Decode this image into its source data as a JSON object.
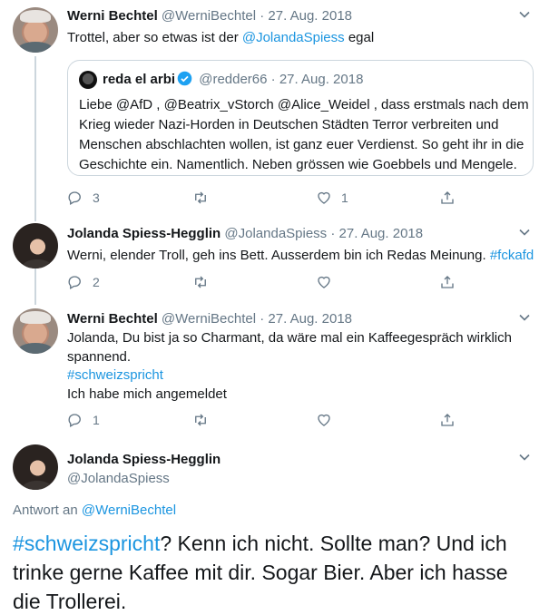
{
  "thread": [
    {
      "avatar": "werni",
      "name": "Werni Bechtel",
      "handle": "@WerniBechtel",
      "date": "· 27. Aug. 2018",
      "text_pre": "Trottel, aber so etwas ist der ",
      "text_mention": "@JolandaSpiess",
      "text_post": " egal",
      "quote": {
        "name": "reda el arbi",
        "handle": "@redder66",
        "date": "· 27. Aug. 2018",
        "lines": [
          "Liebe @AfD , @Beatrix_vStorch @Alice_Weidel , dass erstmals nach dem",
          "Krieg wieder Nazi-Horden in Deutschen Städten Terror verbreiten und",
          "Menschen abschlachten wollen, ist ganz euer Verdienst. So geht ihr in die",
          "Geschichte ein. Namentlich. Neben grössen wie Goebbels und Mengele."
        ]
      },
      "replies": "3",
      "retweets": "",
      "likes": "1"
    },
    {
      "avatar": "jolanda",
      "name": "Jolanda Spiess-Hegglin",
      "handle": "@JolandaSpiess",
      "date": "· 27. Aug. 2018",
      "text_pre": "Werni, elender Troll, geh ins Bett. Ausserdem bin ich Redas Meinung. ",
      "text_hashtag": "#fckafd",
      "replies": "2",
      "retweets": "",
      "likes": ""
    },
    {
      "avatar": "werni",
      "name": "Werni Bechtel",
      "handle": "@WerniBechtel",
      "date": "· 27. Aug. 2018",
      "lines": [
        "Jolanda, Du bist ja so Charmant, da wäre mal ein Kaffeegespräch wirklich",
        "spannend."
      ],
      "hashtag_line": "#schweizspricht",
      "last_line": "Ich habe mich angemeldet",
      "replies": "1",
      "retweets": "",
      "likes": ""
    }
  ],
  "main_tweet": {
    "avatar": "jolanda",
    "name": "Jolanda Spiess-Hegglin",
    "handle": "@JolandaSpiess",
    "reply_label": "Antwort an ",
    "reply_to": "@WerniBechtel",
    "hashtag": "#schweizspricht",
    "text_lines": [
      "? Kenn ich nicht. Sollte man? Und ich",
      "trinke gerne Kaffee mit dir. Sogar Bier. Aber ich hasse",
      "die Trollerei."
    ]
  },
  "colors": {
    "link": "#1b95e0",
    "muted": "#657786",
    "text": "#14171a",
    "border": "#ccd6dd"
  },
  "icons": [
    "chevron-down-icon",
    "reply-icon",
    "retweet-icon",
    "like-icon",
    "share-icon",
    "verified-icon"
  ]
}
